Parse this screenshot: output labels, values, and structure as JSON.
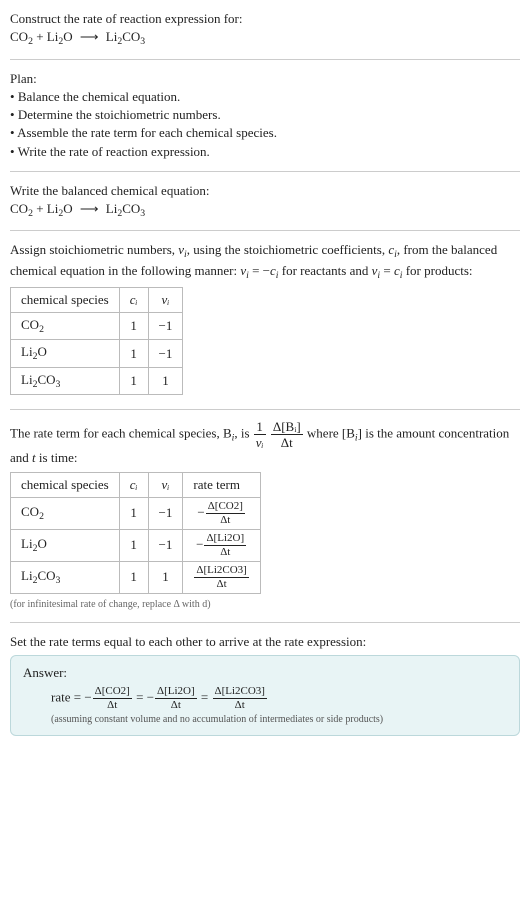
{
  "header": {
    "prompt": "Construct the rate of reaction expression for:",
    "equation_lhs1": "CO",
    "equation_lhs1_sub": "2",
    "plus1": " + ",
    "equation_lhs2a": "Li",
    "equation_lhs2a_sub": "2",
    "equation_lhs2b": "O",
    "arrow": "⟶",
    "equation_rhs_a": "Li",
    "equation_rhs_a_sub": "2",
    "equation_rhs_b": "CO",
    "equation_rhs_b_sub": "3"
  },
  "plan": {
    "title": "Plan:",
    "items": [
      "Balance the chemical equation.",
      "Determine the stoichiometric numbers.",
      "Assemble the rate term for each chemical species.",
      "Write the rate of reaction expression."
    ]
  },
  "balanced": {
    "title": "Write the balanced chemical equation:"
  },
  "stoich_text": {
    "part1": "Assign stoichiometric numbers, ",
    "nu_i": "ν",
    "nu_i_sub": "i",
    "part2": ", using the stoichiometric coefficients, ",
    "c_i": "c",
    "c_i_sub": "i",
    "part3": ", from the balanced chemical equation in the following manner: ",
    "rel1_lhs": "ν",
    "rel1_lhs_sub": "i",
    "rel1_eq": " = −",
    "rel1_rhs": "c",
    "rel1_rhs_sub": "i",
    "part4": " for reactants and ",
    "rel2_lhs": "ν",
    "rel2_lhs_sub": "i",
    "rel2_eq": " = ",
    "rel2_rhs": "c",
    "rel2_rhs_sub": "i",
    "part5": " for products:"
  },
  "stoich_table": {
    "headers": {
      "species": "chemical species",
      "c": "cᵢ",
      "nu": "νᵢ"
    },
    "rows": [
      {
        "species_html": "CO<sub>2</sub>",
        "c": "1",
        "nu": "−1"
      },
      {
        "species_html": "Li<sub>2</sub>O",
        "c": "1",
        "nu": "−1"
      },
      {
        "species_html": "Li<sub>2</sub>CO<sub>3</sub>",
        "c": "1",
        "nu": "1"
      }
    ]
  },
  "rate_term_text": {
    "part1": "The rate term for each chemical species, B",
    "b_sub": "i",
    "part2": ", is ",
    "frac1_num": "1",
    "frac1_den": "νᵢ",
    "frac2_num": "Δ[Bᵢ]",
    "frac2_den": "Δt",
    "part3": " where [B",
    "part3_sub": "i",
    "part4": "] is the amount concentration and ",
    "t": "t",
    "part5": " is time:"
  },
  "rate_table": {
    "headers": {
      "species": "chemical species",
      "c": "cᵢ",
      "nu": "νᵢ",
      "term": "rate term"
    },
    "rows": [
      {
        "species_html": "CO<sub>2</sub>",
        "c": "1",
        "nu": "−1",
        "sign": "−",
        "num": "Δ[CO2]",
        "den": "Δt"
      },
      {
        "species_html": "Li<sub>2</sub>O",
        "c": "1",
        "nu": "−1",
        "sign": "−",
        "num": "Δ[Li2O]",
        "den": "Δt"
      },
      {
        "species_html": "Li<sub>2</sub>CO<sub>3</sub>",
        "c": "1",
        "nu": "1",
        "sign": "",
        "num": "Δ[Li2CO3]",
        "den": "Δt"
      }
    ],
    "note": "(for infinitesimal rate of change, replace Δ with d)"
  },
  "set_equal": "Set the rate terms equal to each other to arrive at the rate expression:",
  "answer": {
    "label": "Answer:",
    "rate_label": "rate = ",
    "t1_sign": "−",
    "t1_num": "Δ[CO2]",
    "t1_den": "Δt",
    "eq1": " = ",
    "t2_sign": "−",
    "t2_num": "Δ[Li2O]",
    "t2_den": "Δt",
    "eq2": " = ",
    "t3_sign": "",
    "t3_num": "Δ[Li2CO3]",
    "t3_den": "Δt",
    "note": "(assuming constant volume and no accumulation of intermediates or side products)"
  }
}
